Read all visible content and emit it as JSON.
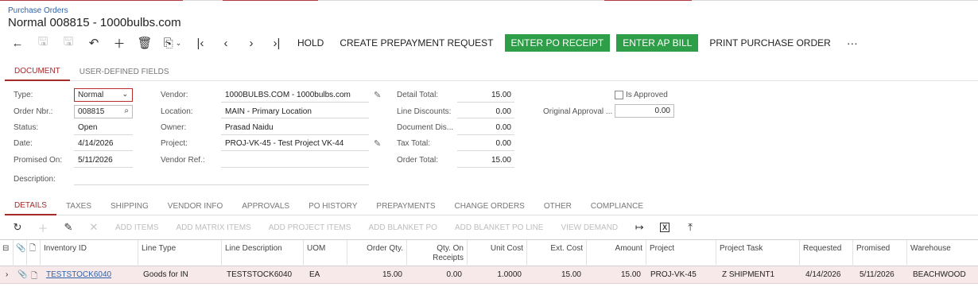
{
  "breadcrumb": "Purchase Orders",
  "title": "Normal 008815 - 1000bulbs.com",
  "toolbar": {
    "hold": "HOLD",
    "create_prepayment": "CREATE PREPAYMENT REQUEST",
    "enter_po_receipt": "ENTER PO RECEIPT",
    "enter_ap_bill": "ENTER AP BILL",
    "print_po": "PRINT PURCHASE ORDER",
    "more": "···"
  },
  "form_tabs": [
    "DOCUMENT",
    "USER-DEFINED FIELDS"
  ],
  "form": {
    "type_label": "Type:",
    "type_value": "Normal",
    "order_nbr_label": "Order Nbr.:",
    "order_nbr_value": "008815",
    "status_label": "Status:",
    "status_value": "Open",
    "date_label": "Date:",
    "date_value": "4/14/2026",
    "promised_label": "Promised On:",
    "promised_value": "5/11/2026",
    "description_label": "Description:",
    "vendor_label": "Vendor:",
    "vendor_value": "1000BULBS.COM - 1000bulbs.com",
    "location_label": "Location:",
    "location_value": "MAIN - Primary Location",
    "owner_label": "Owner:",
    "owner_value": "Prasad Naidu",
    "project_label": "Project:",
    "project_value": "PROJ-VK-45 - Test Project VK-44",
    "vendor_ref_label": "Vendor Ref.:",
    "detail_total_label": "Detail Total:",
    "detail_total_value": "15.00",
    "line_discounts_label": "Line Discounts:",
    "line_discounts_value": "0.00",
    "doc_discount_label": "Document Dis...",
    "doc_discount_value": "0.00",
    "tax_total_label": "Tax Total:",
    "tax_total_value": "0.00",
    "order_total_label": "Order Total:",
    "order_total_value": "15.00",
    "is_approved_label": "Is Approved",
    "orig_approval_label": "Original Approval ...",
    "orig_approval_value": "0.00"
  },
  "detail_tabs": [
    "DETAILS",
    "TAXES",
    "SHIPPING",
    "VENDOR INFO",
    "APPROVALS",
    "PO HISTORY",
    "PREPAYMENTS",
    "CHANGE ORDERS",
    "OTHER",
    "COMPLIANCE"
  ],
  "grid_toolbar": [
    "ADD ITEMS",
    "ADD MATRIX ITEMS",
    "ADD PROJECT ITEMS",
    "ADD BLANKET PO",
    "ADD BLANKET PO LINE",
    "VIEW DEMAND"
  ],
  "grid": {
    "columns": [
      "Inventory ID",
      "Line Type",
      "Line Description",
      "UOM",
      "Order Qty.",
      "Qty. On Receipts",
      "Unit Cost",
      "Ext. Cost",
      "Amount",
      "Project",
      "Project Task",
      "Requested",
      "Promised",
      "Warehouse"
    ],
    "rows": [
      [
        "TESTSTOCK6040",
        "Goods for IN",
        "TESTSTOCK6040",
        "EA",
        "15.00",
        "0.00",
        "1.0000",
        "15.00",
        "15.00",
        "PROJ-VK-45",
        "Z SHIPMENT1",
        "4/14/2026",
        "5/11/2026",
        "BEACHWOOD"
      ]
    ]
  },
  "colors": {
    "accent": "#a52a2a",
    "green": "#2e9f48",
    "link": "#2d62a8",
    "row_highlight": "#f7e9ea"
  }
}
